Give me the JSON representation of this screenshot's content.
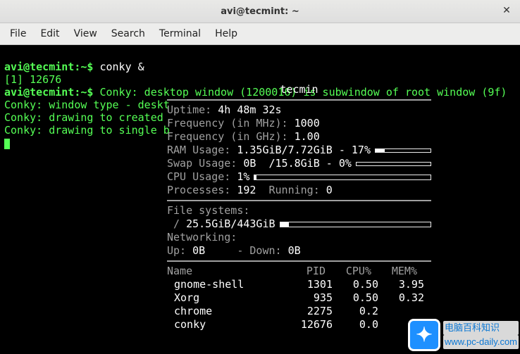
{
  "titlebar": {
    "title": "avi@tecmint: ~",
    "close": "✕"
  },
  "menubar": {
    "file": "File",
    "edit": "Edit",
    "view": "View",
    "search": "Search",
    "terminal": "Terminal",
    "help": "Help"
  },
  "terminal": {
    "prompt1": "avi@tecmint:~$ ",
    "cmd1": "conky &",
    "job": "[1] 12676",
    "prompt2": "avi@tecmint:~$ ",
    "msg1": "Conky: desktop window (1200016) is subwindow of root window (9f)",
    "msg2": "Conky: window type - deskt",
    "msg3": "Conky: drawing to created ",
    "msg4": "Conky: drawing to single b"
  },
  "conky": {
    "host": "tecmin",
    "labels": {
      "uptime": "Uptime: ",
      "freq_mhz": "Frequency (in MHz): ",
      "freq_ghz": "Frequency (in GHz): ",
      "ram": "RAM Usage: ",
      "swap": "Swap Usage: ",
      "cpu": "CPU Usage: ",
      "processes": "Processes: ",
      "running": "  Running: ",
      "filesystems": "File systems:",
      "root": " / ",
      "networking": "Networking:",
      "up": "Up: ",
      "down": " - Down: ",
      "proc_name": "Name",
      "proc_pid": "PID",
      "proc_cpu": "CPU%",
      "proc_mem": "MEM%"
    },
    "values": {
      "uptime": "4h 48m 32s",
      "freq_mhz": "1000",
      "freq_ghz": "1.00",
      "ram": "1.35GiB/7.72GiB - 17%",
      "ram_pct": 17,
      "swap": "0B  /15.8GiB - 0%",
      "swap_pct": 0,
      "cpu": "1%",
      "cpu_pct": 1,
      "processes": "192",
      "running": "0",
      "fs_root": "25.5GiB/443GiB",
      "fs_root_pct": 6,
      "net_up": "0B",
      "net_down": "0B"
    },
    "processes": [
      {
        "name": "gnome-shell",
        "pid": "1301",
        "cpu": "0.50",
        "mem": "3.95"
      },
      {
        "name": "Xorg",
        "pid": "935",
        "cpu": "0.50",
        "mem": "0.32"
      },
      {
        "name": "chrome",
        "pid": "2275",
        "cpu": "0.2",
        "mem": ""
      },
      {
        "name": "conky",
        "pid": "12676",
        "cpu": "0.0",
        "mem": ""
      }
    ]
  },
  "watermark": {
    "glyph": "✦",
    "line1": "电脑百科知识",
    "line2": "www.pc-daily.com"
  }
}
